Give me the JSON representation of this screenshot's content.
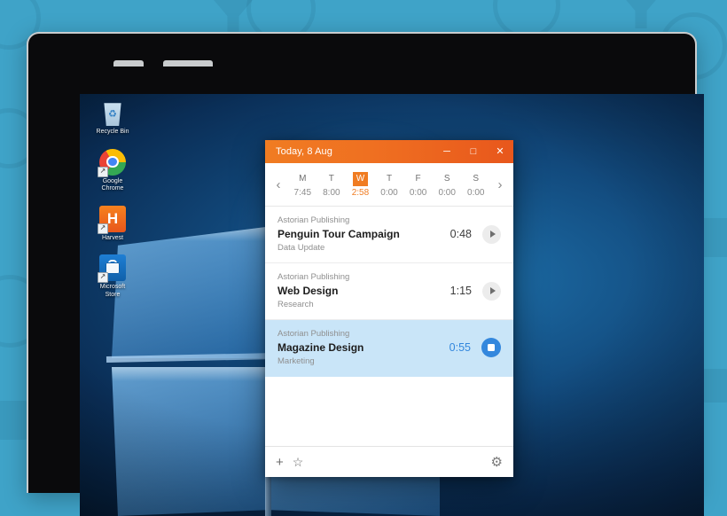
{
  "backdrop": {
    "color": "#3fa3c8"
  },
  "desktop": {
    "icons": [
      {
        "name": "recycle-bin",
        "label": "Recycle Bin",
        "shortcut": false
      },
      {
        "name": "google-chrome",
        "label": "Google\nChrome",
        "label_line1": "Google",
        "label_line2": "Chrome",
        "shortcut": true
      },
      {
        "name": "harvest",
        "label": "Harvest",
        "letter": "H",
        "shortcut": true
      },
      {
        "name": "microsoft-store",
        "label_line1": "Microsoft",
        "label_line2": "Store",
        "shortcut": true
      }
    ]
  },
  "app": {
    "titlebar": {
      "title": "Today, 8 Aug",
      "minimize": "─",
      "maximize": "□",
      "close": "✕",
      "color_start": "#f07c22",
      "color_end": "#e8571c"
    },
    "daystrip": {
      "prev": "‹",
      "next": "›",
      "accent": "#f07c22",
      "days": [
        {
          "letter": "M",
          "time": "7:45",
          "active": false
        },
        {
          "letter": "T",
          "time": "8:00",
          "active": false
        },
        {
          "letter": "W",
          "time": "2:58",
          "active": true
        },
        {
          "letter": "T",
          "time": "0:00",
          "active": false
        },
        {
          "letter": "F",
          "time": "0:00",
          "active": false
        },
        {
          "letter": "S",
          "time": "0:00",
          "active": false
        },
        {
          "letter": "S",
          "time": "0:00",
          "active": false
        }
      ]
    },
    "entries": [
      {
        "client": "Astorian Publishing",
        "task": "Penguin Tour Campaign",
        "category": "Data Update",
        "duration": "0:48",
        "running": false,
        "button_icon": "play-icon"
      },
      {
        "client": "Astorian Publishing",
        "task": "Web Design",
        "category": "Research",
        "duration": "1:15",
        "running": false,
        "button_icon": "play-icon"
      },
      {
        "client": "Astorian Publishing",
        "task": "Magazine Design",
        "category": "Marketing",
        "duration": "0:55",
        "running": true,
        "button_icon": "stop-icon",
        "accent": "#3387dd",
        "row_background": "#c9e5f8"
      }
    ],
    "toolbar": {
      "add": "+",
      "favorite": "☆",
      "settings": "⚙"
    }
  }
}
